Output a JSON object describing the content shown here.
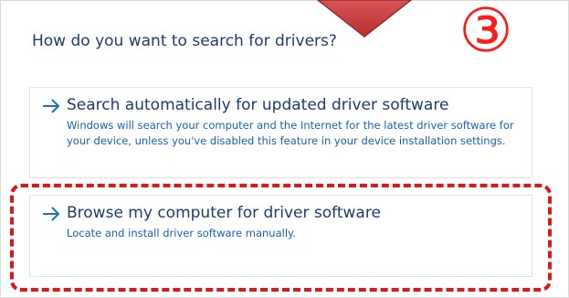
{
  "dialog": {
    "question": "How do you want to search for drivers?"
  },
  "options": [
    {
      "title": "Search automatically for updated driver software",
      "description": "Windows will search your computer and the Internet for the latest driver software for your device, unless you've disabled this feature in your device installation settings."
    },
    {
      "title": "Browse my computer for driver software",
      "description": "Locate and install driver software manually."
    }
  ],
  "annotations": {
    "step_number": "③",
    "highlight_color": "#e51515",
    "arrow_color": "#c73b3b"
  },
  "colors": {
    "heading": "#1f3b6e",
    "link_text": "#1b5fbd",
    "accent": "#1b6ec2"
  }
}
